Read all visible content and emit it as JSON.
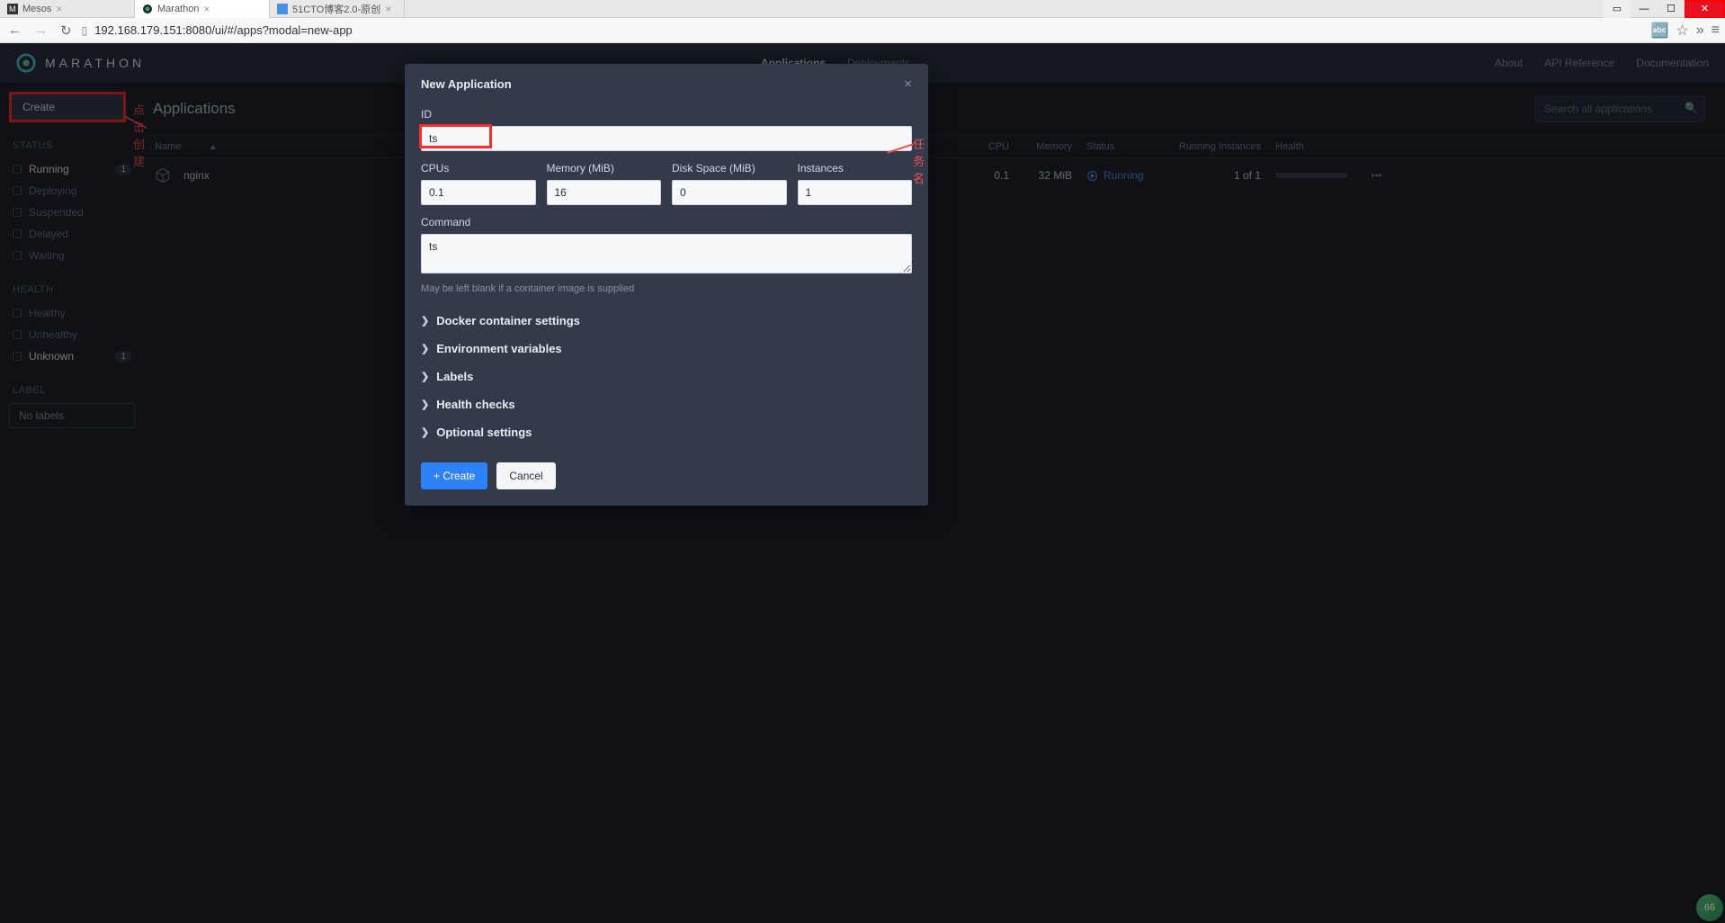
{
  "browser": {
    "tabs": [
      {
        "title": "Mesos",
        "active": false
      },
      {
        "title": "Marathon",
        "active": true
      },
      {
        "title": "51CTO博客2.0-原创",
        "active": false
      }
    ],
    "url": "192.168.179.151:8080/ui/#/apps?modal=new-app"
  },
  "brand": "MARATHON",
  "nav": {
    "applications": "Applications",
    "deployments": "Deployments"
  },
  "right_nav": {
    "about": "About",
    "api": "API Reference",
    "docs": "Documentation"
  },
  "create_label": "Create",
  "annot_create": "点击创建",
  "sidebar": {
    "status_head": "STATUS",
    "status": [
      {
        "label": "Running",
        "count": "1",
        "active": true
      },
      {
        "label": "Deploying"
      },
      {
        "label": "Suspended"
      },
      {
        "label": "Delayed"
      },
      {
        "label": "Waiting"
      }
    ],
    "health_head": "HEALTH",
    "health": [
      {
        "label": "Healthy"
      },
      {
        "label": "Unhealthy"
      },
      {
        "label": "Unknown",
        "count": "1",
        "active": true
      }
    ],
    "label_head": "LABEL",
    "nolabels": "No labels"
  },
  "page_title": "Applications",
  "search_placeholder": "Search all applications",
  "columns": {
    "name": "Name",
    "cpu": "CPU",
    "mem": "Memory",
    "status": "Status",
    "inst": "Running Instances",
    "health": "Health"
  },
  "rows": [
    {
      "name": "nginx",
      "cpu": "0.1",
      "mem": "32 MiB",
      "status": "Running",
      "inst": "1 of 1"
    }
  ],
  "modal": {
    "title": "New Application",
    "id_label": "ID",
    "id_value": "ts",
    "annot_id": "任务名",
    "cpus_label": "CPUs",
    "cpus_value": "0.1",
    "mem_label": "Memory (MiB)",
    "mem_value": "16",
    "disk_label": "Disk Space (MiB)",
    "disk_value": "0",
    "inst_label": "Instances",
    "inst_value": "1",
    "cmd_label": "Command",
    "cmd_value": "ts",
    "cmd_hint": "May be left blank if a container image is supplied",
    "sections": [
      "Docker container settings",
      "Environment variables",
      "Labels",
      "Health checks",
      "Optional settings"
    ],
    "create": "+ Create",
    "cancel": "Cancel"
  },
  "float_badge": "66"
}
